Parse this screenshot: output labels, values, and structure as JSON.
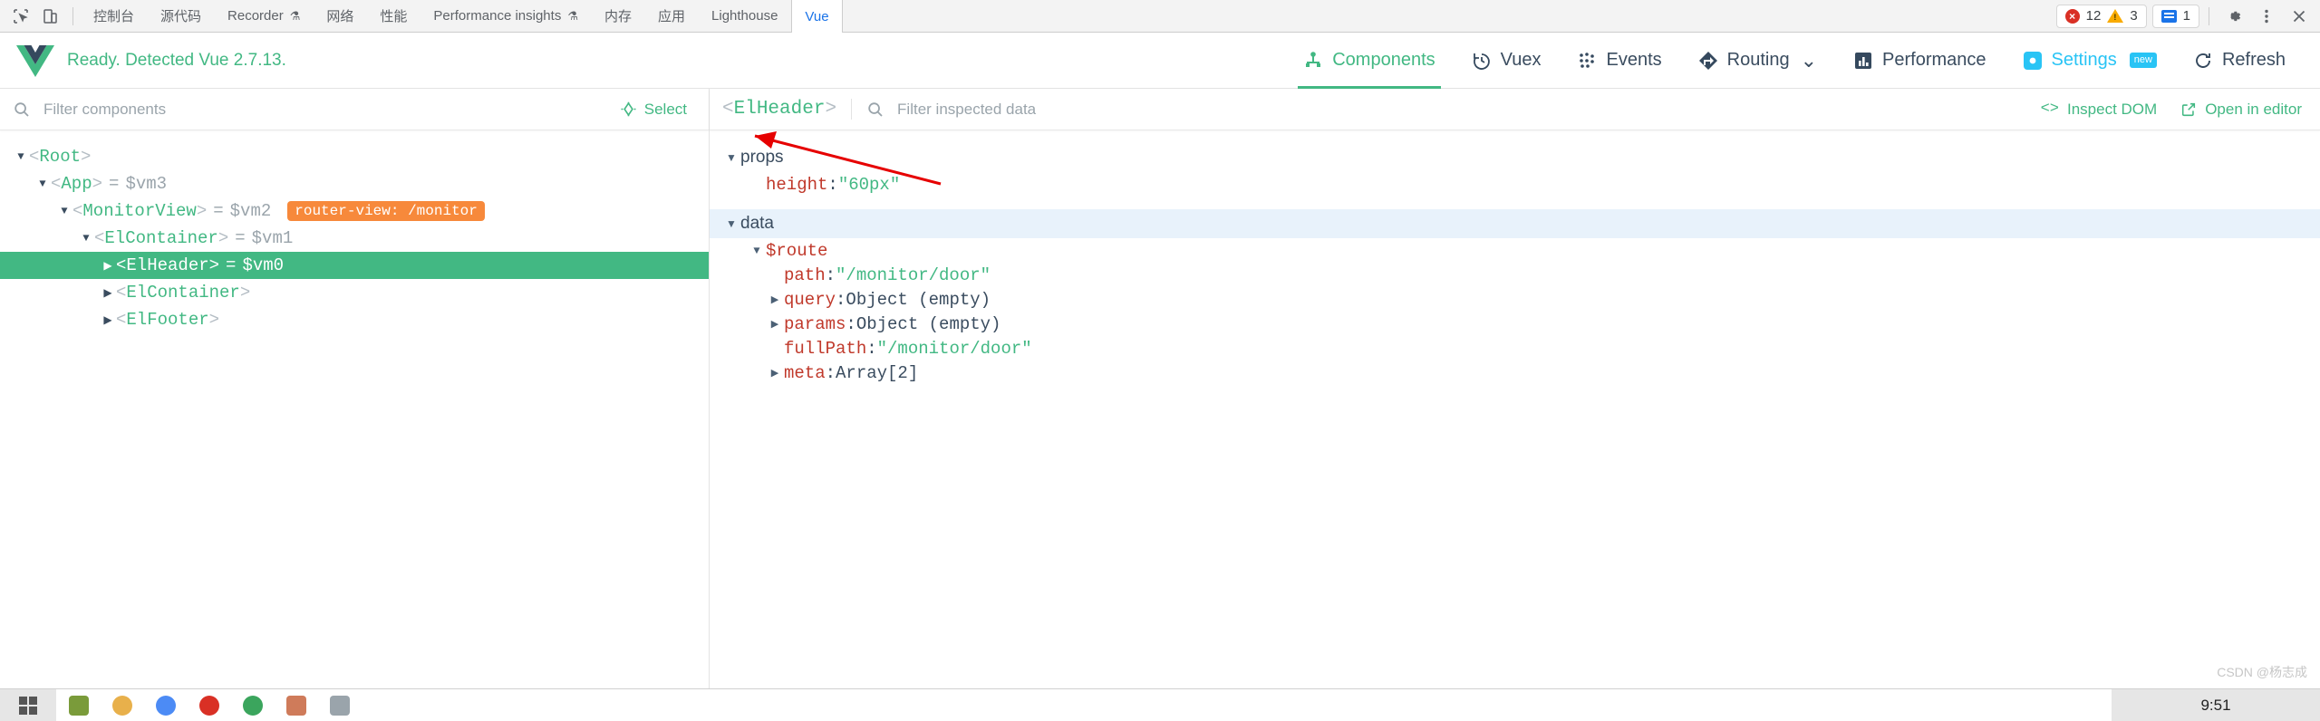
{
  "devtools": {
    "icons": {
      "inspect": "inspect-element-icon",
      "device": "device-toolbar-icon"
    },
    "tabs": [
      {
        "label": "控制台",
        "active": false,
        "flask": false
      },
      {
        "label": "源代码",
        "active": false,
        "flask": false
      },
      {
        "label": "Recorder",
        "active": false,
        "flask": true
      },
      {
        "label": "网络",
        "active": false,
        "flask": false
      },
      {
        "label": "性能",
        "active": false,
        "flask": false
      },
      {
        "label": "Performance insights",
        "active": false,
        "flask": true
      },
      {
        "label": "内存",
        "active": false,
        "flask": false
      },
      {
        "label": "应用",
        "active": false,
        "flask": false
      },
      {
        "label": "Lighthouse",
        "active": false,
        "flask": false
      },
      {
        "label": "Vue",
        "active": true,
        "flask": false
      }
    ],
    "errors_count": "12",
    "warnings_count": "3",
    "messages_count": "1",
    "colors": {
      "error": "#d93025",
      "warning": "#f9ab00",
      "message": "#1a73e8",
      "active_tab": "#1a73e8"
    }
  },
  "vue_header": {
    "ready_text": "Ready. Detected Vue 2.7.13.",
    "accent": "#42b883",
    "nav": [
      {
        "label": "Components",
        "icon": "components-tree-icon",
        "active": true,
        "style": "active",
        "chevron": false,
        "badge": ""
      },
      {
        "label": "Vuex",
        "icon": "vuex-history-icon",
        "active": false,
        "style": "normal",
        "chevron": false,
        "badge": ""
      },
      {
        "label": "Events",
        "icon": "events-dots-icon",
        "active": false,
        "style": "normal",
        "chevron": false,
        "badge": ""
      },
      {
        "label": "Routing",
        "icon": "routing-diamond-icon",
        "active": false,
        "style": "normal",
        "chevron": true,
        "badge": ""
      },
      {
        "label": "Performance",
        "icon": "performance-bars-icon",
        "active": false,
        "style": "normal",
        "chevron": false,
        "badge": ""
      },
      {
        "label": "Settings",
        "icon": "gear-icon",
        "active": false,
        "style": "settings",
        "chevron": false,
        "badge": "new"
      },
      {
        "label": "Refresh",
        "icon": "refresh-icon",
        "active": false,
        "style": "normal",
        "chevron": false,
        "badge": ""
      }
    ]
  },
  "left_pane": {
    "filter_placeholder": "Filter components",
    "filter_value": "",
    "select_label": "Select",
    "tree": [
      {
        "depth": 0,
        "arrow": "down",
        "name": "Root",
        "vm": "",
        "tag": "",
        "selected": false
      },
      {
        "depth": 1,
        "arrow": "down",
        "name": "App",
        "vm": "$vm3",
        "tag": "",
        "selected": false
      },
      {
        "depth": 2,
        "arrow": "down",
        "name": "MonitorView",
        "vm": "$vm2",
        "tag": "router-view: /monitor",
        "selected": false
      },
      {
        "depth": 3,
        "arrow": "down",
        "name": "ElContainer",
        "vm": "$vm1",
        "tag": "",
        "selected": false
      },
      {
        "depth": 4,
        "arrow": "right",
        "name": "ElHeader",
        "vm": "$vm0",
        "tag": "",
        "selected": true
      },
      {
        "depth": 4,
        "arrow": "right",
        "name": "ElContainer",
        "vm": "",
        "tag": "",
        "selected": false
      },
      {
        "depth": 4,
        "arrow": "right",
        "name": "ElFooter",
        "vm": "",
        "tag": "",
        "selected": false
      }
    ]
  },
  "right_pane": {
    "component_name": "ElHeader",
    "filter_placeholder": "Filter inspected data",
    "filter_value": "",
    "inspect_dom_label": "Inspect DOM",
    "open_in_editor_label": "Open in editor",
    "sections": [
      {
        "title": "props",
        "highlighted": false,
        "rows": [
          {
            "indent": 1,
            "arrow": "none",
            "key": "height",
            "key_color": "red",
            "sep": ": ",
            "value": "\"60px\"",
            "value_style": "string"
          }
        ]
      },
      {
        "title": "data",
        "highlighted": true,
        "rows": [
          {
            "indent": 1,
            "arrow": "down",
            "key": "$route",
            "key_color": "red",
            "sep": "",
            "value": "",
            "value_style": "none"
          },
          {
            "indent": 2,
            "arrow": "none",
            "key": "path",
            "key_color": "red",
            "sep": ": ",
            "value": "\"/monitor/door\"",
            "value_style": "string"
          },
          {
            "indent": 2,
            "arrow": "right",
            "key": "query",
            "key_color": "red",
            "sep": ": ",
            "value": "Object (empty)",
            "value_style": "muted"
          },
          {
            "indent": 2,
            "arrow": "right",
            "key": "params",
            "key_color": "red",
            "sep": ": ",
            "value": "Object (empty)",
            "value_style": "muted"
          },
          {
            "indent": 2,
            "arrow": "none",
            "key": "fullPath",
            "key_color": "red",
            "sep": ": ",
            "value": "\"/monitor/door\"",
            "value_style": "string"
          },
          {
            "indent": 2,
            "arrow": "right",
            "key": "meta",
            "key_color": "red",
            "sep": ": ",
            "value": "Array[2]",
            "value_style": "muted"
          }
        ]
      }
    ],
    "annotation": {
      "type": "arrow",
      "color": "#e60000"
    }
  },
  "taskbar": {
    "clock": "9:51",
    "watermark": "CSDN @杨志成"
  }
}
